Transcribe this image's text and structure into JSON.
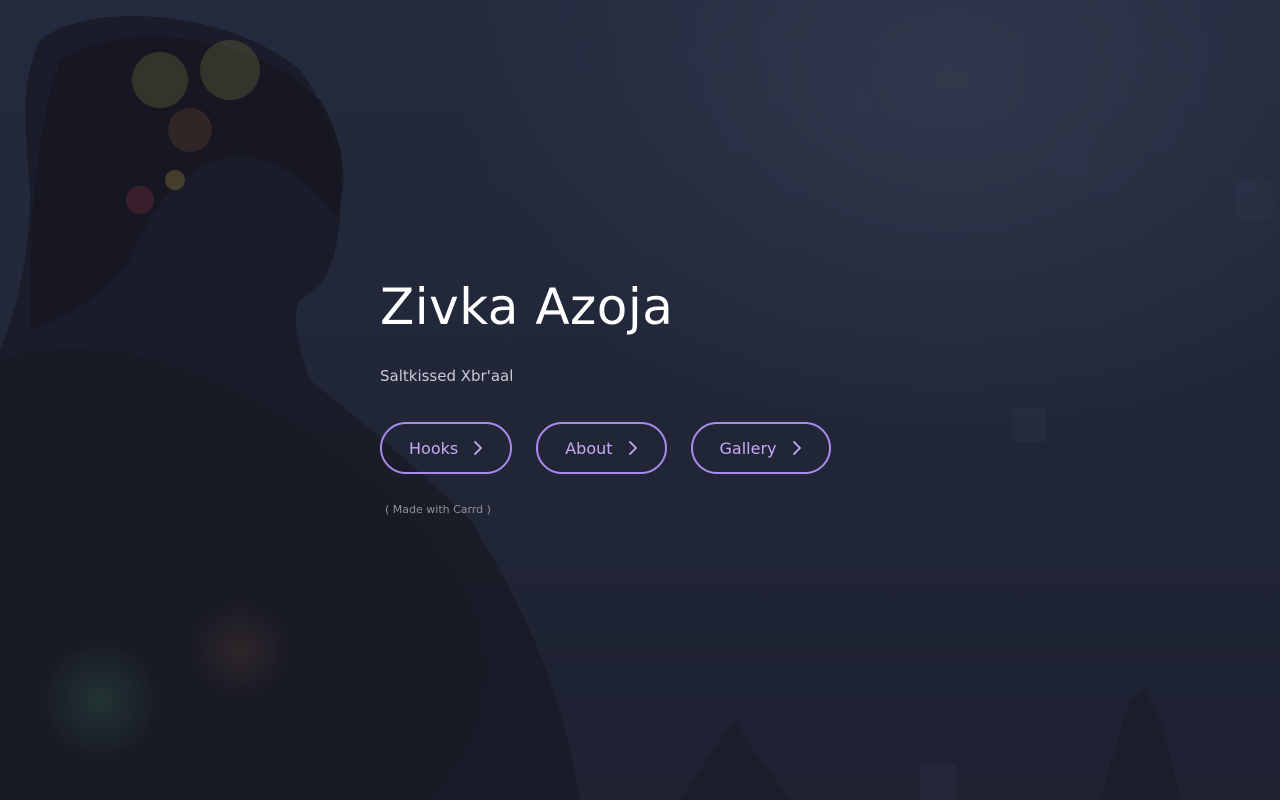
{
  "page": {
    "title": "Zivka Azoja",
    "subtitle": "Saltkissed Xbr'aal"
  },
  "buttons": [
    {
      "label": "Hooks",
      "icon": "chevron-right-icon"
    },
    {
      "label": "About",
      "icon": "chevron-right-icon"
    },
    {
      "label": "Gallery",
      "icon": "chevron-right-icon"
    }
  ],
  "footer": {
    "credit": "( Made with Carrd )"
  },
  "colors": {
    "background": "#222838",
    "accent": "#a98aec",
    "title": "#ffffff",
    "subtitle": "#c9cad3",
    "credit": "#8e8f99"
  }
}
